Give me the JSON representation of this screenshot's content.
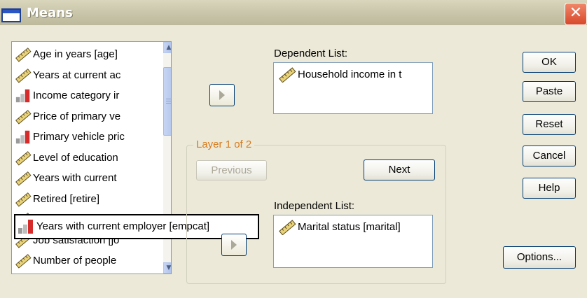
{
  "window": {
    "title": "Means",
    "close_glyph": "✕"
  },
  "variables": {
    "items": [
      {
        "label": "Age in years [age]",
        "icon": "ruler-icon"
      },
      {
        "label": "Years at current ac",
        "icon": "ruler-icon"
      },
      {
        "label": "Income category ir",
        "icon": "ordinal-bars-icon"
      },
      {
        "label": "Price of primary ve",
        "icon": "ruler-icon"
      },
      {
        "label": "Primary vehicle pric",
        "icon": "ordinal-bars-icon"
      },
      {
        "label": "Level of education",
        "icon": "ruler-icon"
      },
      {
        "label": "Years with current",
        "icon": "ruler-icon"
      },
      {
        "label": "Retired [retire]",
        "icon": "ruler-icon"
      },
      {
        "label": "",
        "icon": "ruler-icon"
      },
      {
        "label": "Job satisfaction [jo",
        "icon": "ruler-icon"
      },
      {
        "label": "Number of people",
        "icon": "ruler-icon"
      }
    ],
    "tooltip": {
      "label": "Years with current employer [empcat]",
      "icon": "ordinal-bars-icon"
    }
  },
  "dependent": {
    "label": "Dependent List:",
    "items": [
      {
        "label": "Household income in t",
        "icon": "ruler-icon"
      }
    ]
  },
  "layer": {
    "legend": "Layer 1 of 2",
    "previous_label": "Previous",
    "next_label": "Next"
  },
  "independent": {
    "label": "Independent List:",
    "items": [
      {
        "label": "Marital status [marital]",
        "icon": "ruler-icon"
      }
    ]
  },
  "buttons": {
    "ok": "OK",
    "paste": "Paste",
    "reset": "Reset",
    "cancel": "Cancel",
    "help": "Help",
    "options": "Options..."
  },
  "colors": {
    "layer_legend": "#d77b1f",
    "close_button": "#d8482a",
    "scale_icon_bar": "#d62b2b"
  }
}
